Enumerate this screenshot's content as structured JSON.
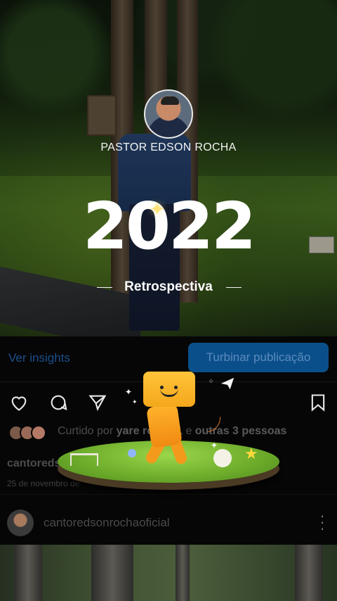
{
  "story": {
    "author_name": "PASTOR EDSON ROCHA",
    "year": "2022",
    "subtitle": "Retrospectiva"
  },
  "post": {
    "insights_label": "Ver insights",
    "boost_label": "Turbinar publicação",
    "actions": [
      "heart-icon",
      "comment-icon",
      "share-icon",
      "bookmark-icon"
    ],
    "liked_prefix": "Curtido por ",
    "liked_user": "yare",
    "liked_mid": "rocha.1",
    "liked_connector": " e ",
    "liked_others": "outras 3 pessoas",
    "caption_user": "cantoreds",
    "caption_tail": "!",
    "date": "25 de novembro de",
    "account_name": "cantoredsonrochaoficial"
  },
  "colors": {
    "boost_bg": "#0b4f8a",
    "insights_text": "#1c4f8c",
    "mascot": "#ffc43a"
  }
}
